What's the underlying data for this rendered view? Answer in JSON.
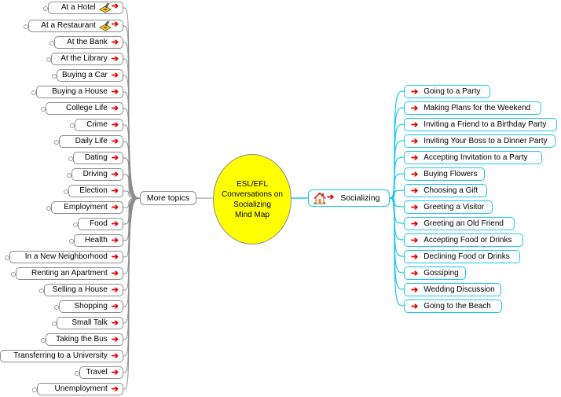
{
  "colors": {
    "center_fill": "#ffff00",
    "left_link": "#8c8c8c",
    "right_link": "#19c8ec",
    "arrow": "#e00000"
  },
  "center": {
    "lines": [
      "ESL/EFL",
      "Conversations on",
      "Socializing",
      "Mind Map"
    ]
  },
  "left_branch": {
    "label": "More topics",
    "items": [
      {
        "label": "At a Hotel",
        "icon": "food-tray-icon"
      },
      {
        "label": "At a Restaurant",
        "icon": "food-tray-icon"
      },
      {
        "label": "At the Bank"
      },
      {
        "label": "At the Library"
      },
      {
        "label": "Buying a Car"
      },
      {
        "label": "Buying a House"
      },
      {
        "label": "College Life"
      },
      {
        "label": "Crime"
      },
      {
        "label": "Daily Life"
      },
      {
        "label": "Dating"
      },
      {
        "label": "Driving"
      },
      {
        "label": "Election"
      },
      {
        "label": "Employment"
      },
      {
        "label": "Food"
      },
      {
        "label": "Health"
      },
      {
        "label": "In a New Neighborhood"
      },
      {
        "label": "Renting an Apartment"
      },
      {
        "label": "Selling a House"
      },
      {
        "label": "Shopping"
      },
      {
        "label": "Small Talk"
      },
      {
        "label": "Taking the Bus"
      },
      {
        "label": "Transferring to a University"
      },
      {
        "label": "Travel"
      },
      {
        "label": "Unemployment"
      }
    ]
  },
  "right_branch": {
    "label": "Socializing",
    "icon": "house-icon",
    "items": [
      {
        "label": "Going to a Party"
      },
      {
        "label": "Making Plans for the Weekend"
      },
      {
        "label": "Inviting a Friend to a Birthday Party"
      },
      {
        "label": "Inviting Your Boss to a Dinner Party"
      },
      {
        "label": "Accepting Invitation to a Party"
      },
      {
        "label": "Buying Flowers"
      },
      {
        "label": "Choosing a Gift"
      },
      {
        "label": "Greeting a Visitor"
      },
      {
        "label": "Greeting an Old Friend"
      },
      {
        "label": "Accepting Food or Drinks"
      },
      {
        "label": "Declining Food or Drinks"
      },
      {
        "label": "Gossiping"
      },
      {
        "label": "Wedding Discussion"
      },
      {
        "label": "Going to the Beach"
      }
    ]
  },
  "arrow_glyph": "➔"
}
